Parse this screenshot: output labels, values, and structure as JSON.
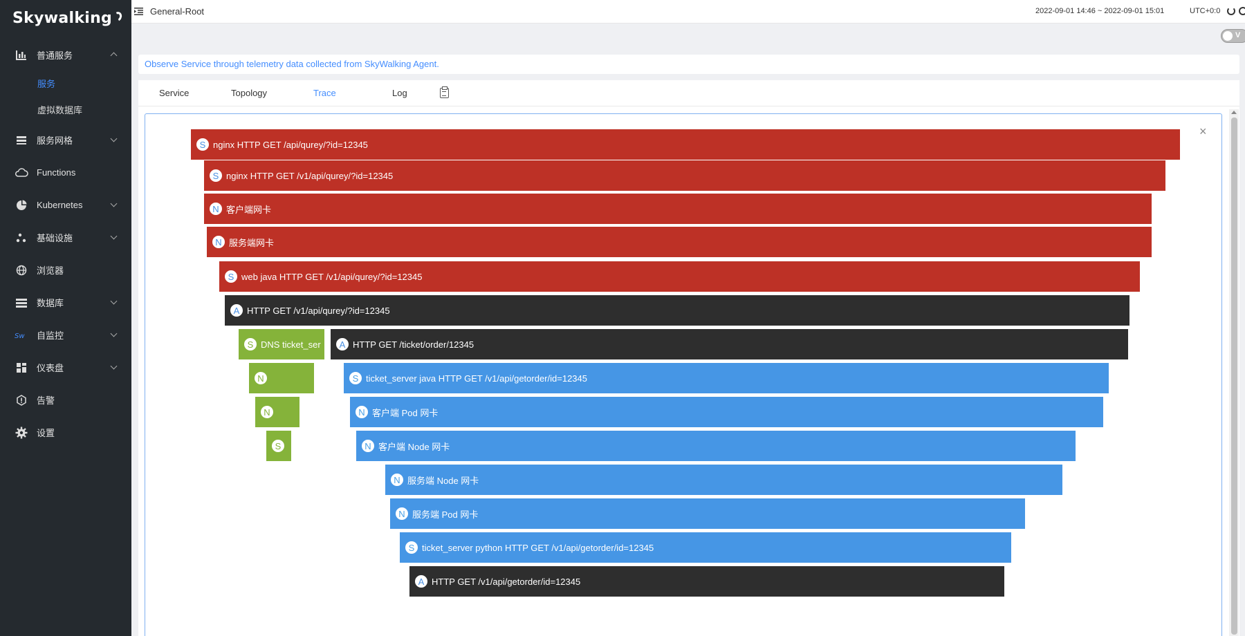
{
  "sidebar": {
    "logo": "Skywalking",
    "items": [
      {
        "label": "普通服务",
        "icon": "bar-chart-icon",
        "expandable": true,
        "expanded": true
      },
      {
        "label": "服务网格",
        "icon": "layers-icon",
        "expandable": true
      },
      {
        "label": "Functions",
        "icon": "cloud-icon",
        "expandable": false
      },
      {
        "label": "Kubernetes",
        "icon": "pie-chart-icon",
        "expandable": true
      },
      {
        "label": "基础设施",
        "icon": "nodes-icon",
        "expandable": true
      },
      {
        "label": "浏览器",
        "icon": "globe-icon",
        "expandable": false
      },
      {
        "label": "数据库",
        "icon": "list-icon",
        "expandable": true
      },
      {
        "label": "自监控",
        "icon": "sw-icon",
        "expandable": true
      },
      {
        "label": "仪表盘",
        "icon": "dashboard-icon",
        "expandable": true
      },
      {
        "label": "告警",
        "icon": "alarm-icon",
        "expandable": false
      },
      {
        "label": "设置",
        "icon": "gear-icon",
        "expandable": false
      }
    ],
    "subitems": [
      {
        "label": "服务",
        "active": true
      },
      {
        "label": "虚拟数据库",
        "active": false
      }
    ]
  },
  "topbar": {
    "title": "General-Root",
    "daterange": "2022-09-01 14:46 ~ 2022-09-01 15:01",
    "timezone": "UTC+0:0"
  },
  "toggle_label": "V",
  "hint": "Observe Service through telemetry data collected from SkyWalking Agent.",
  "tabs": [
    {
      "label": "Service",
      "active": false
    },
    {
      "label": "Topology",
      "active": false
    },
    {
      "label": "Trace",
      "active": true
    },
    {
      "label": "Log",
      "active": false
    }
  ],
  "colors": {
    "red": "#bd3126",
    "dark": "#2e2e2e",
    "green": "#85b33a",
    "blue": "#4696e5",
    "accent": "#448dfe"
  },
  "spans": [
    {
      "badge": "S",
      "label": "nginx  HTTP GET /api/qurey/?id=12345",
      "color": "red"
    },
    {
      "badge": "S",
      "label": "nginx HTTP GET /v1/api/qurey/?id=12345",
      "color": "red"
    },
    {
      "badge": "N",
      "label": "客户端网卡",
      "color": "red"
    },
    {
      "badge": "N",
      "label": "服务端网卡",
      "color": "red"
    },
    {
      "badge": "S",
      "label": "web java HTTP GET /v1/api/qurey/?id=12345",
      "color": "red"
    },
    {
      "badge": "A",
      "label": "HTTP GET /v1/api/qurey/?id=12345",
      "color": "dark"
    },
    {
      "badge": "S",
      "label": "DNS ticket_ser",
      "color": "green"
    },
    {
      "badge": "A",
      "label": "HTTP GET /ticket/order/12345",
      "color": "dark"
    },
    {
      "badge": "N",
      "label": "",
      "color": "green"
    },
    {
      "badge": "S",
      "label": "ticket_server  java HTTP GET /v1/api/getorder/id=12345",
      "color": "blue"
    },
    {
      "badge": "N",
      "label": "",
      "color": "green"
    },
    {
      "badge": "N",
      "label": "客户端 Pod 网卡",
      "color": "blue"
    },
    {
      "badge": "S",
      "label": "",
      "color": "green"
    },
    {
      "badge": "N",
      "label": "客户端 Node 网卡",
      "color": "blue"
    },
    {
      "badge": "N",
      "label": "服务端 Node 网卡",
      "color": "blue"
    },
    {
      "badge": "N",
      "label": "服务端 Pod 网卡",
      "color": "blue"
    },
    {
      "badge": "S",
      "label": "ticket_server  python HTTP GET  /v1/api/getorder/id=12345",
      "color": "blue"
    },
    {
      "badge": "A",
      "label": "HTTP GET  /v1/api/getorder/id=12345",
      "color": "dark"
    }
  ]
}
